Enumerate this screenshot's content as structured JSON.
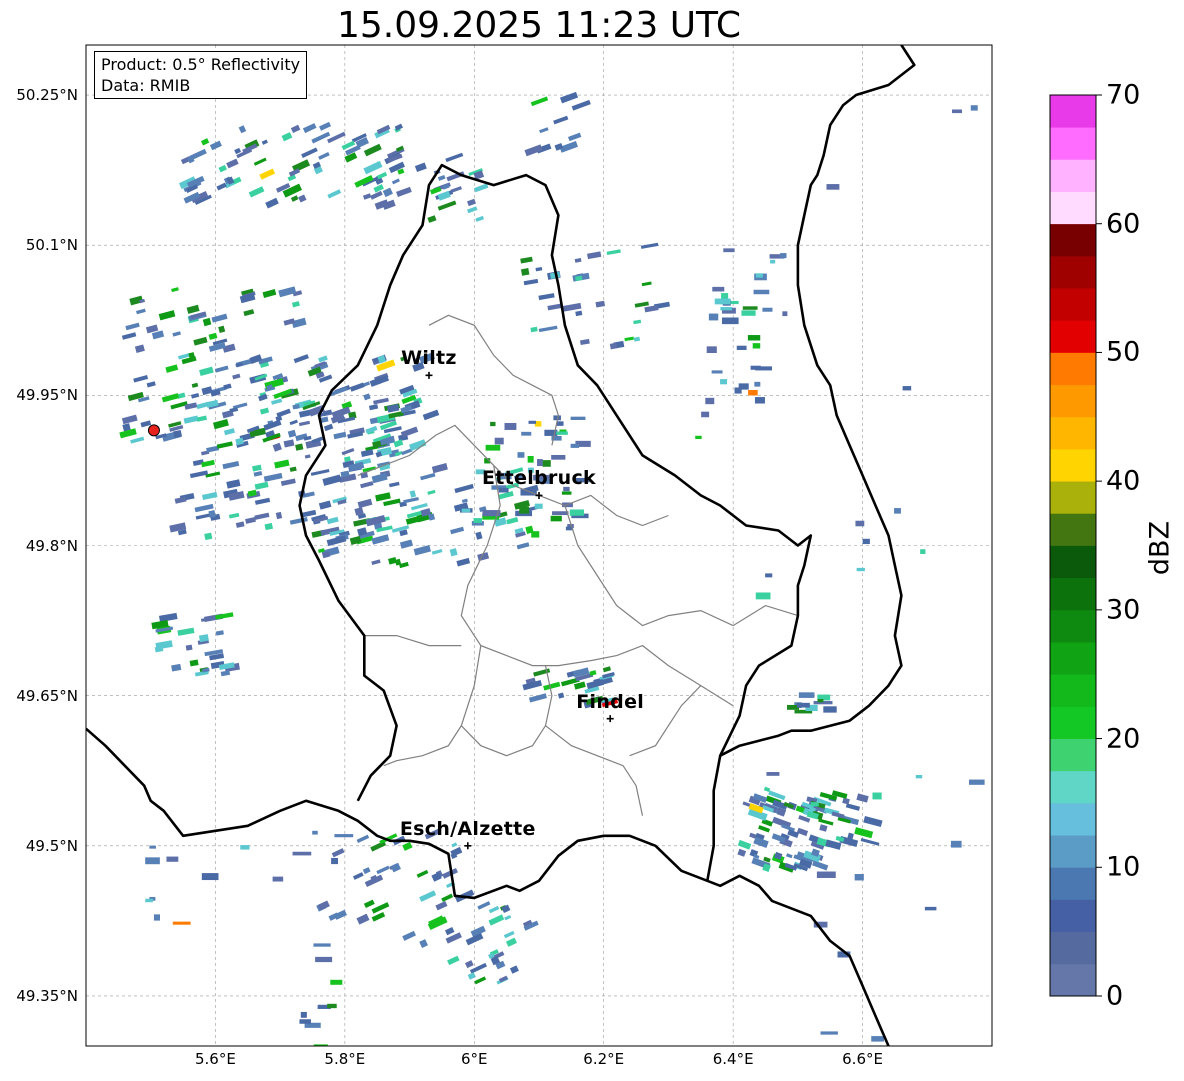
{
  "title": "15.09.2025 11:23 UTC",
  "info_box": {
    "product": "Product: 0.5° Reflectivity",
    "data_source": "Data: RMIB"
  },
  "map_extent": {
    "lon": [
      5.4,
      6.8
    ],
    "lat": [
      49.3,
      50.3
    ]
  },
  "lat_ticks": [
    {
      "value": 50.25,
      "label": "50.25°N"
    },
    {
      "value": 50.1,
      "label": "50.1°N"
    },
    {
      "value": 49.95,
      "label": "49.95°N"
    },
    {
      "value": 49.8,
      "label": "49.8°N"
    },
    {
      "value": 49.65,
      "label": "49.65°N"
    },
    {
      "value": 49.5,
      "label": "49.5°N"
    },
    {
      "value": 49.35,
      "label": "49.35°N"
    }
  ],
  "lon_ticks": [
    {
      "value": 5.6,
      "label": "5.6°E"
    },
    {
      "value": 5.8,
      "label": "5.8°E"
    },
    {
      "value": 6.0,
      "label": "6°E"
    },
    {
      "value": 6.2,
      "label": "6.2°E"
    },
    {
      "value": 6.4,
      "label": "6.4°E"
    },
    {
      "value": 6.6,
      "label": "6.6°E"
    }
  ],
  "cities": [
    {
      "name": "Wiltz",
      "lon": 5.93,
      "lat": 49.97
    },
    {
      "name": "Ettelbruck",
      "lon": 6.1,
      "lat": 49.85
    },
    {
      "name": "Findel",
      "lon": 6.21,
      "lat": 49.627
    },
    {
      "name": "Esch/Alzette",
      "lon": 5.99,
      "lat": 49.5
    }
  ],
  "radar_site": {
    "lon": 5.505,
    "lat": 49.915,
    "color": "#e8221c"
  },
  "colorbar": {
    "label": "dBZ",
    "min": 0,
    "max": 70,
    "ticks": [
      {
        "value": 0,
        "label": "0"
      },
      {
        "value": 10,
        "label": "10"
      },
      {
        "value": 20,
        "label": "20"
      },
      {
        "value": 30,
        "label": "30"
      },
      {
        "value": 40,
        "label": "40"
      },
      {
        "value": 50,
        "label": "50"
      },
      {
        "value": 60,
        "label": "60"
      },
      {
        "value": 70,
        "label": "70"
      }
    ],
    "colors": [
      "#6477a8",
      "#556a9f",
      "#4660a5",
      "#4b78b0",
      "#5b9cc7",
      "#66bfdc",
      "#5fd6c6",
      "#3fd270",
      "#13c824",
      "#13b81a",
      "#10a313",
      "#0f8a10",
      "#0c720c",
      "#0b5a0b",
      "#437510",
      "#a9b10a",
      "#ffd400",
      "#ffb600",
      "#ff9900",
      "#ff7a00",
      "#e30000",
      "#c20000",
      "#9f0000",
      "#780000",
      "#ffdbff",
      "#ffb2ff",
      "#ff6cff",
      "#e93ae9"
    ]
  },
  "echo_colors": {
    "weak": [
      "#5d6fa8",
      "#4a6aa6",
      "#5780b6"
    ],
    "moderate": [
      "#5bc8d0",
      "#3ad0a0"
    ],
    "strong": [
      "#16c21d",
      "#0e9a14",
      "#1c8a1e"
    ],
    "intense": [
      "#ffd400",
      "#ff7a00",
      "#e30000"
    ]
  },
  "borders": {
    "country": [
      [
        5.4,
        49.617
      ],
      [
        5.43,
        49.6
      ],
      [
        5.46,
        49.58
      ],
      [
        5.49,
        49.56
      ],
      [
        5.5,
        49.545
      ],
      [
        5.52,
        49.535
      ],
      [
        5.55,
        49.51
      ],
      [
        5.6,
        49.515
      ],
      [
        5.65,
        49.52
      ],
      [
        5.7,
        49.535
      ],
      [
        5.74,
        49.545
      ],
      [
        5.79,
        49.535
      ],
      [
        5.82,
        49.525
      ],
      [
        5.85,
        49.51
      ],
      [
        5.87,
        49.505
      ],
      [
        5.9,
        49.505
      ],
      [
        5.93,
        49.502
      ],
      [
        5.96,
        49.492
      ],
      [
        5.97,
        49.45
      ],
      [
        6.0,
        49.448
      ],
      [
        6.05,
        49.46
      ],
      [
        6.07,
        49.455
      ],
      [
        6.1,
        49.465
      ],
      [
        6.13,
        49.49
      ],
      [
        6.16,
        49.505
      ],
      [
        6.2,
        49.51
      ],
      [
        6.24,
        49.51
      ],
      [
        6.28,
        49.5
      ],
      [
        6.32,
        49.475
      ],
      [
        6.36,
        49.465
      ],
      [
        6.38,
        49.46
      ],
      [
        6.41,
        49.47
      ],
      [
        6.44,
        49.46
      ],
      [
        6.46,
        49.445
      ],
      [
        6.52,
        49.43
      ],
      [
        6.55,
        49.405
      ],
      [
        6.58,
        49.39
      ],
      [
        6.6,
        49.36
      ],
      [
        6.62,
        49.33
      ],
      [
        6.64,
        49.3
      ]
    ],
    "luxembourg": [
      [
        5.82,
        49.545
      ],
      [
        5.84,
        49.57
      ],
      [
        5.87,
        49.59
      ],
      [
        5.88,
        49.62
      ],
      [
        5.86,
        49.655
      ],
      [
        5.83,
        49.67
      ],
      [
        5.83,
        49.71
      ],
      [
        5.79,
        49.745
      ],
      [
        5.76,
        49.785
      ],
      [
        5.74,
        49.81
      ],
      [
        5.73,
        49.84
      ],
      [
        5.74,
        49.87
      ],
      [
        5.77,
        49.9
      ],
      [
        5.76,
        49.93
      ],
      [
        5.78,
        49.955
      ],
      [
        5.82,
        49.98
      ],
      [
        5.85,
        50.02
      ],
      [
        5.87,
        50.06
      ],
      [
        5.89,
        50.09
      ],
      [
        5.92,
        50.12
      ],
      [
        5.93,
        50.16
      ],
      [
        5.95,
        50.18
      ],
      [
        5.98,
        50.17
      ],
      [
        6.03,
        50.16
      ],
      [
        6.08,
        50.17
      ],
      [
        6.11,
        50.16
      ],
      [
        6.13,
        50.13
      ],
      [
        6.12,
        50.09
      ],
      [
        6.13,
        50.06
      ],
      [
        6.14,
        50.02
      ],
      [
        6.16,
        49.98
      ],
      [
        6.19,
        49.96
      ],
      [
        6.21,
        49.94
      ],
      [
        6.23,
        49.92
      ],
      [
        6.26,
        49.89
      ],
      [
        6.31,
        49.87
      ],
      [
        6.35,
        49.85
      ],
      [
        6.38,
        49.84
      ],
      [
        6.42,
        49.82
      ],
      [
        6.47,
        49.815
      ],
      [
        6.5,
        49.8
      ],
      [
        6.52,
        49.81
      ],
      [
        6.51,
        49.78
      ],
      [
        6.5,
        49.76
      ],
      [
        6.5,
        49.73
      ],
      [
        6.49,
        49.7
      ],
      [
        6.44,
        49.68
      ],
      [
        6.42,
        49.66
      ],
      [
        6.41,
        49.63
      ],
      [
        6.38,
        49.59
      ],
      [
        6.37,
        49.555
      ],
      [
        6.37,
        49.5
      ],
      [
        6.36,
        49.465
      ]
    ],
    "east": [
      [
        6.66,
        50.3
      ],
      [
        6.68,
        50.28
      ],
      [
        6.64,
        50.26
      ],
      [
        6.59,
        50.25
      ],
      [
        6.57,
        50.24
      ],
      [
        6.55,
        50.22
      ],
      [
        6.54,
        50.19
      ],
      [
        6.53,
        50.17
      ],
      [
        6.52,
        50.16
      ],
      [
        6.51,
        50.13
      ],
      [
        6.5,
        50.1
      ],
      [
        6.5,
        50.06
      ],
      [
        6.51,
        50.02
      ],
      [
        6.53,
        49.98
      ],
      [
        6.55,
        49.96
      ],
      [
        6.56,
        49.93
      ],
      [
        6.58,
        49.9
      ],
      [
        6.6,
        49.87
      ],
      [
        6.62,
        49.84
      ],
      [
        6.64,
        49.81
      ],
      [
        6.65,
        49.78
      ],
      [
        6.66,
        49.75
      ],
      [
        6.65,
        49.71
      ],
      [
        6.66,
        49.68
      ],
      [
        6.64,
        49.66
      ],
      [
        6.61,
        49.64
      ],
      [
        6.58,
        49.625
      ],
      [
        6.55,
        49.62
      ],
      [
        6.52,
        49.615
      ],
      [
        6.49,
        49.615
      ],
      [
        6.47,
        49.61
      ],
      [
        6.44,
        49.605
      ],
      [
        6.41,
        49.6
      ],
      [
        6.38,
        49.59
      ]
    ],
    "cantons": [
      [
        [
          5.93,
          50.02
        ],
        [
          5.96,
          50.03
        ],
        [
          6.0,
          50.02
        ],
        [
          6.03,
          49.99
        ],
        [
          6.06,
          49.97
        ],
        [
          6.09,
          49.96
        ],
        [
          6.12,
          49.95
        ],
        [
          6.13,
          49.93
        ],
        [
          6.12,
          49.9
        ]
      ],
      [
        [
          5.82,
          49.87
        ],
        [
          5.86,
          49.88
        ],
        [
          5.9,
          49.89
        ],
        [
          5.94,
          49.91
        ],
        [
          5.97,
          49.92
        ],
        [
          6.0,
          49.9
        ],
        [
          6.03,
          49.88
        ],
        [
          6.06,
          49.86
        ],
        [
          6.1,
          49.85
        ],
        [
          6.14,
          49.84
        ],
        [
          6.18,
          49.85
        ],
        [
          6.22,
          49.83
        ],
        [
          6.26,
          49.82
        ],
        [
          6.3,
          49.83
        ]
      ],
      [
        [
          6.03,
          49.88
        ],
        [
          6.04,
          49.84
        ],
        [
          6.02,
          49.8
        ],
        [
          5.99,
          49.76
        ],
        [
          5.98,
          49.73
        ],
        [
          6.01,
          49.7
        ],
        [
          6.05,
          49.69
        ],
        [
          6.09,
          49.68
        ],
        [
          6.13,
          49.68
        ],
        [
          6.18,
          49.685
        ],
        [
          6.22,
          49.69
        ],
        [
          6.26,
          49.7
        ],
        [
          6.3,
          49.68
        ],
        [
          6.35,
          49.66
        ],
        [
          6.4,
          49.64
        ]
      ],
      [
        [
          6.14,
          49.84
        ],
        [
          6.16,
          49.8
        ],
        [
          6.19,
          49.77
        ],
        [
          6.22,
          49.74
        ],
        [
          6.26,
          49.72
        ],
        [
          6.3,
          49.73
        ],
        [
          6.35,
          49.735
        ],
        [
          6.4,
          49.72
        ],
        [
          6.45,
          49.74
        ],
        [
          6.5,
          49.73
        ]
      ],
      [
        [
          5.83,
          49.71
        ],
        [
          5.88,
          49.71
        ],
        [
          5.93,
          49.7
        ],
        [
          5.98,
          49.7
        ]
      ],
      [
        [
          6.01,
          49.7
        ],
        [
          6.0,
          49.66
        ],
        [
          5.98,
          49.62
        ],
        [
          5.96,
          49.6
        ],
        [
          5.92,
          49.59
        ],
        [
          5.88,
          49.585
        ],
        [
          5.86,
          49.58
        ]
      ],
      [
        [
          6.11,
          49.68
        ],
        [
          6.12,
          49.65
        ],
        [
          6.11,
          49.62
        ],
        [
          6.09,
          49.6
        ],
        [
          6.05,
          49.59
        ],
        [
          6.01,
          49.6
        ],
        [
          5.98,
          49.62
        ]
      ],
      [
        [
          6.11,
          49.62
        ],
        [
          6.15,
          49.6
        ],
        [
          6.19,
          49.59
        ],
        [
          6.23,
          49.58
        ],
        [
          6.25,
          49.56
        ],
        [
          6.26,
          49.53
        ]
      ],
      [
        [
          6.24,
          49.59
        ],
        [
          6.28,
          49.6
        ],
        [
          6.3,
          49.62
        ],
        [
          6.32,
          49.64
        ],
        [
          6.35,
          49.66
        ]
      ]
    ]
  }
}
